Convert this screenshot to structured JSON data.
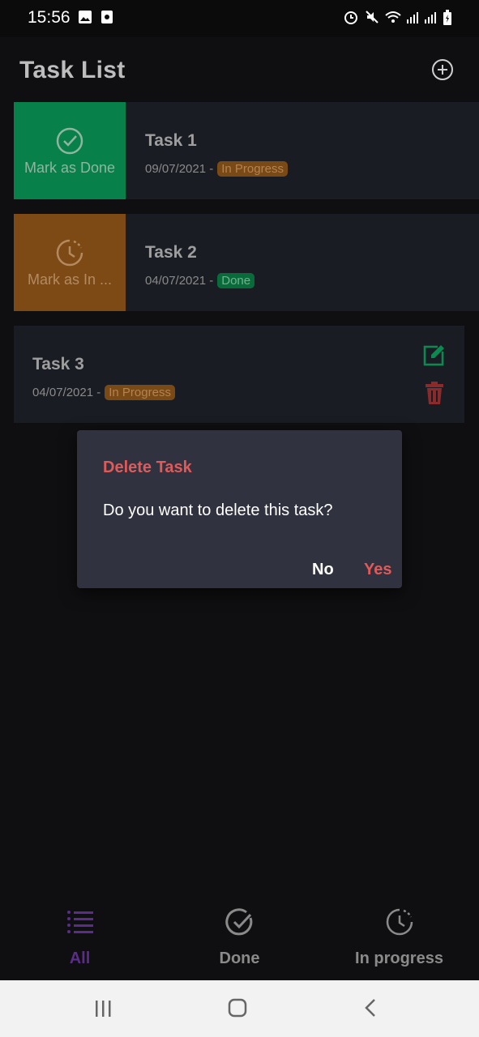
{
  "status_bar": {
    "time": "15:56"
  },
  "app_bar": {
    "title": "Task List",
    "add_icon": "add-circle-icon"
  },
  "tasks": [
    {
      "title": "Task 1",
      "date": "09/07/2021 -",
      "status": "In Progress",
      "swipe_action": "Mark as Done",
      "swipe_color": "#07804a"
    },
    {
      "title": "Task 2",
      "date": "04/07/2021 -",
      "status": "Done",
      "swipe_action": "Mark as In ...",
      "swipe_color": "#7d4a16"
    },
    {
      "title": "Task 3",
      "date": "04/07/2021 -",
      "status": "In Progress"
    }
  ],
  "dialog": {
    "title": "Delete Task",
    "message": "Do you want to delete this task?",
    "no_label": "No",
    "yes_label": "Yes"
  },
  "bottom_nav": [
    {
      "label": "All",
      "icon": "list-icon",
      "active": true
    },
    {
      "label": "Done",
      "icon": "check-circle-icon"
    },
    {
      "label": "In progress",
      "icon": "clock-progress-icon"
    }
  ],
  "colors": {
    "accent": "#e05a5a",
    "done": "#07804a",
    "progress": "#7d4a16",
    "active_nav": "#5b2c8a"
  }
}
